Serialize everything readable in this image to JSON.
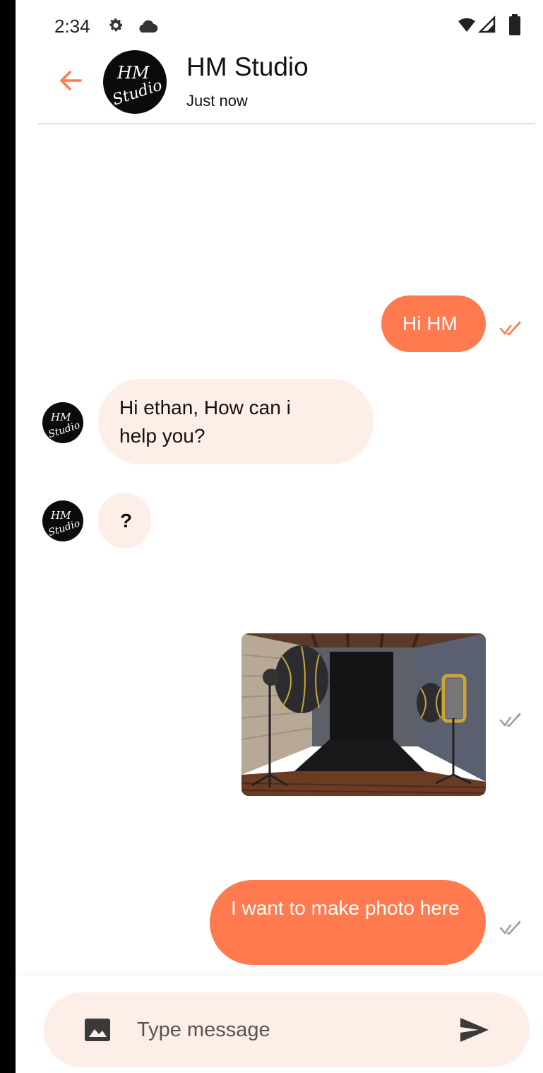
{
  "status_bar": {
    "time": "2:34",
    "icons": [
      "gear-icon",
      "cloud-icon",
      "wifi-icon",
      "signal-icon",
      "battery-icon"
    ]
  },
  "header": {
    "back_icon": "arrow-left-icon",
    "avatar_logo_text": "HM Studio",
    "title": "HM Studio",
    "status": "Just now"
  },
  "messages": [
    {
      "side": "sent",
      "type": "text",
      "text": "Hi HM",
      "status_icon": "double-check-icon",
      "status_color": "#FF7A4F"
    },
    {
      "side": "received",
      "type": "text",
      "text": "Hi ethan, How can i help you?"
    },
    {
      "side": "received",
      "type": "text",
      "text": "?"
    },
    {
      "side": "sent",
      "type": "image",
      "image_description_icon": "photo-studio-image",
      "status_icon": "double-check-icon",
      "status_color": "#9E9E9E"
    },
    {
      "side": "sent",
      "type": "text",
      "text": "I want to make photo here",
      "status_icon": "double-check-icon",
      "status_color": "#9E9E9E"
    }
  ],
  "input_bar": {
    "image_icon": "image-icon",
    "placeholder": "Type message",
    "value": "",
    "send_icon": "send-icon"
  },
  "colors": {
    "accent": "#FF7A4F",
    "received_bubble": "#FDEEE8",
    "input_background": "#FDEEE8",
    "read_tick": "#FF7A4F",
    "unread_tick": "#9E9E9E"
  }
}
